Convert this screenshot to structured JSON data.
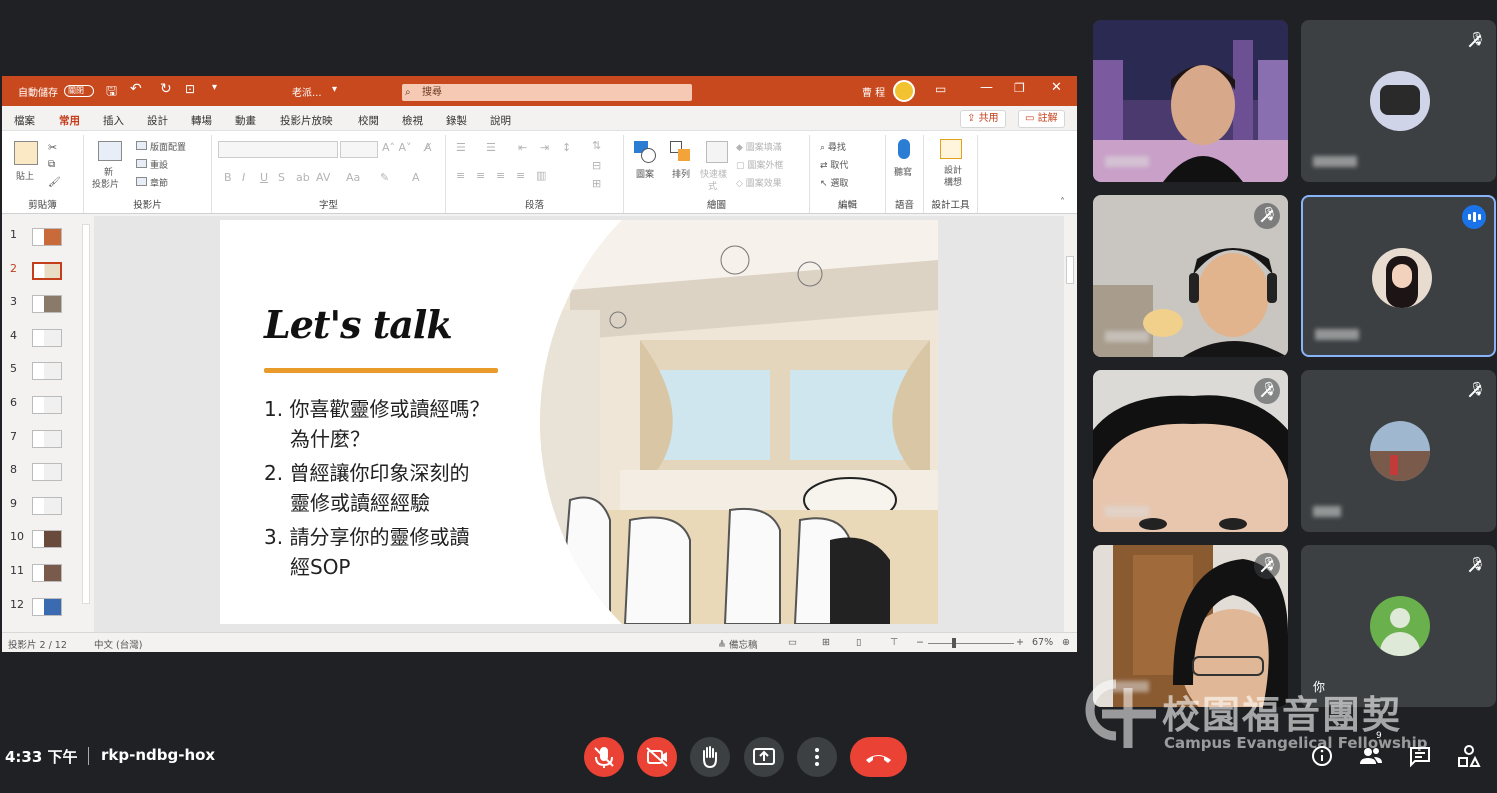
{
  "ppt": {
    "autosave_label": "自動儲存",
    "autosave_state": "關閉",
    "doc_name": "老派...",
    "search_placeholder": "搜尋",
    "user_name": "曹 程",
    "tabs": [
      "檔案",
      "常用",
      "插入",
      "設計",
      "轉場",
      "動畫",
      "投影片放映",
      "校閱",
      "檢視",
      "錄製",
      "說明"
    ],
    "active_tab": "常用",
    "share_label": "共用",
    "comment_label": "註解",
    "ribbon": {
      "paste": "貼上",
      "clipboard": "剪貼簿",
      "new_slide_1": "新",
      "new_slide_2": "投影片",
      "layout": "版面配置",
      "reset": "重設",
      "section": "章節",
      "slides_group": "投影片",
      "font_group": "字型",
      "paragraph_group": "段落",
      "shapes": "圖案",
      "arrange": "排列",
      "quick_styles_1": "快速樣",
      "quick_styles_2": "式",
      "shape_fill": "圖案填滿",
      "shape_outline": "圖案外框",
      "shape_effects": "圖案效果",
      "drawing_group": "繪圖",
      "find": "尋找",
      "replace": "取代",
      "select": "選取",
      "editing_group": "編輯",
      "dictate": "聽寫",
      "voice_group": "語音",
      "designer_1": "設計",
      "designer_2": "構想",
      "designer_group": "設計工具"
    },
    "slide_numbers": [
      "1",
      "2",
      "3",
      "4",
      "5",
      "6",
      "7",
      "8",
      "9",
      "10",
      "11",
      "12"
    ],
    "current_slide_index": 1,
    "slide": {
      "title": "Let's talk",
      "lines": [
        "1. 你喜歡靈修或讀經嗎？",
        "為什麼？",
        "2. 曾經讓你印象深刻的",
        "靈修或讀經經驗",
        "3. 請分享你的靈修或讀",
        "經SOP"
      ]
    },
    "status": {
      "slide_count": "投影片 2 / 12",
      "language": "中文 (台灣)",
      "notes": "備忘稿",
      "zoom": "67%"
    }
  },
  "tiles": [
    {
      "name": "",
      "muted": false,
      "type": "video"
    },
    {
      "name": "",
      "muted": true,
      "type": "avatar"
    },
    {
      "name": "",
      "muted": true,
      "type": "video"
    },
    {
      "name": "",
      "muted": false,
      "speaking": true,
      "type": "avatar"
    },
    {
      "name": "",
      "muted": true,
      "type": "video"
    },
    {
      "name": "",
      "muted": true,
      "type": "avatar"
    },
    {
      "name": "",
      "muted": true,
      "type": "video"
    },
    {
      "name": "你",
      "muted": true,
      "type": "avatar"
    }
  ],
  "meet": {
    "time": "4:33 下午",
    "meeting_code": "rkp-ndbg-hox",
    "participant_count": "9"
  },
  "watermark": {
    "title": "校園福音團契",
    "subtitle": "Campus Evangelical Fellowship"
  },
  "colors": {
    "ppt_accent": "#c43e1c",
    "meet_bg": "#202124",
    "tile_bg": "#3c4043",
    "danger": "#ea4335",
    "speaking": "#8ab4f8"
  }
}
